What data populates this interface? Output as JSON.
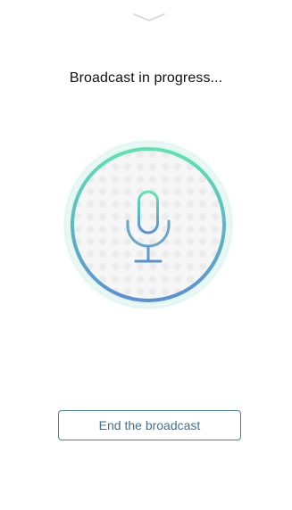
{
  "status": {
    "title": "Broadcast in progress..."
  },
  "actions": {
    "end_label": "End the broadcast"
  },
  "icons": {
    "collapse": "chevron-down-icon",
    "microphone": "microphone-icon"
  },
  "colors": {
    "ring_gradient_top": "#5ee3b0",
    "ring_gradient_bottom": "#5b8fd4",
    "button_border": "#4a7fb1",
    "button_text": "#3f6f9b",
    "title_text": "#111111"
  }
}
